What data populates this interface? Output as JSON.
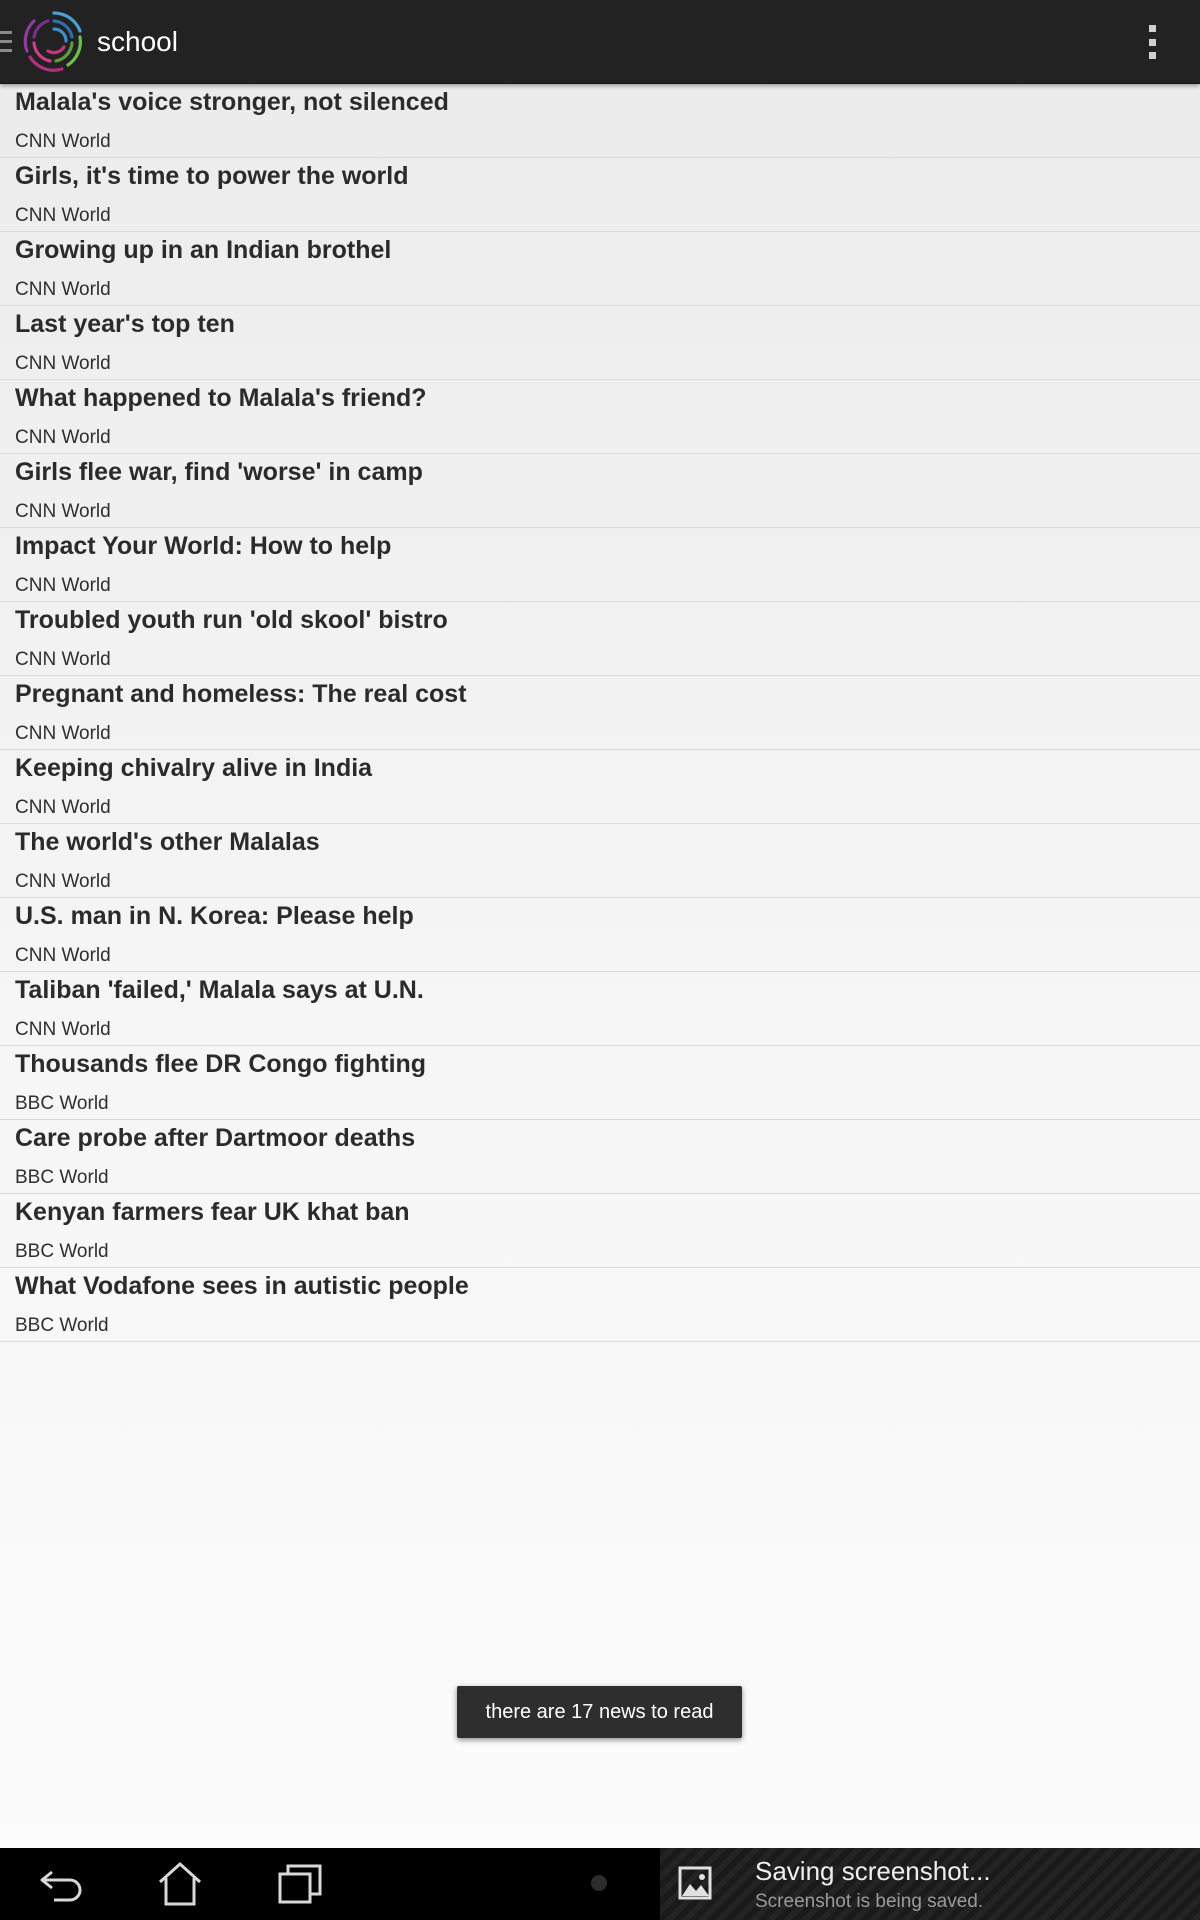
{
  "action_bar": {
    "title": "school",
    "logo_icon": "app-logo-swirl-icon",
    "menu_icon": "overflow-menu-icon"
  },
  "news": [
    {
      "title": "Malala's voice stronger, not silenced",
      "source": "CNN World"
    },
    {
      "title": "Girls, it's time to power the world",
      "source": "CNN World"
    },
    {
      "title": "Growing up in an Indian brothel",
      "source": "CNN World"
    },
    {
      "title": "Last year's top ten",
      "source": "CNN World"
    },
    {
      "title": "What happened to Malala's friend?",
      "source": "CNN World"
    },
    {
      "title": "Girls flee war, find 'worse' in camp",
      "source": "CNN World"
    },
    {
      "title": "Impact Your World: How to help",
      "source": "CNN World"
    },
    {
      "title": "Troubled youth run 'old skool' bistro",
      "source": "CNN World"
    },
    {
      "title": "Pregnant and homeless: The real cost",
      "source": "CNN World"
    },
    {
      "title": "Keeping chivalry alive in India",
      "source": "CNN World"
    },
    {
      "title": "The world's other Malalas",
      "source": "CNN World"
    },
    {
      "title": "U.S. man in N. Korea: Please help",
      "source": "CNN World"
    },
    {
      "title": "Taliban 'failed,' Malala says at U.N.",
      "source": "CNN World"
    },
    {
      "title": "Thousands flee DR Congo fighting",
      "source": "BBC World"
    },
    {
      "title": "Care probe after Dartmoor deaths",
      "source": "BBC World"
    },
    {
      "title": "Kenyan farmers fear UK khat ban",
      "source": "BBC World"
    },
    {
      "title": "What Vodafone sees in autistic people",
      "source": "BBC World"
    }
  ],
  "toast": {
    "text": "there are 17 news to read"
  },
  "notification": {
    "title": "Saving screenshot...",
    "subtitle": "Screenshot is being saved.",
    "icon": "image-icon"
  },
  "nav_bar": {
    "back_icon": "back-icon",
    "home_icon": "home-icon",
    "recents_icon": "recent-apps-icon"
  },
  "colors": {
    "action_bar_bg": "#222222",
    "list_bg": "#f0f0f0",
    "toast_bg": "#2e2e2e",
    "nav_bar_bg": "#000000"
  }
}
